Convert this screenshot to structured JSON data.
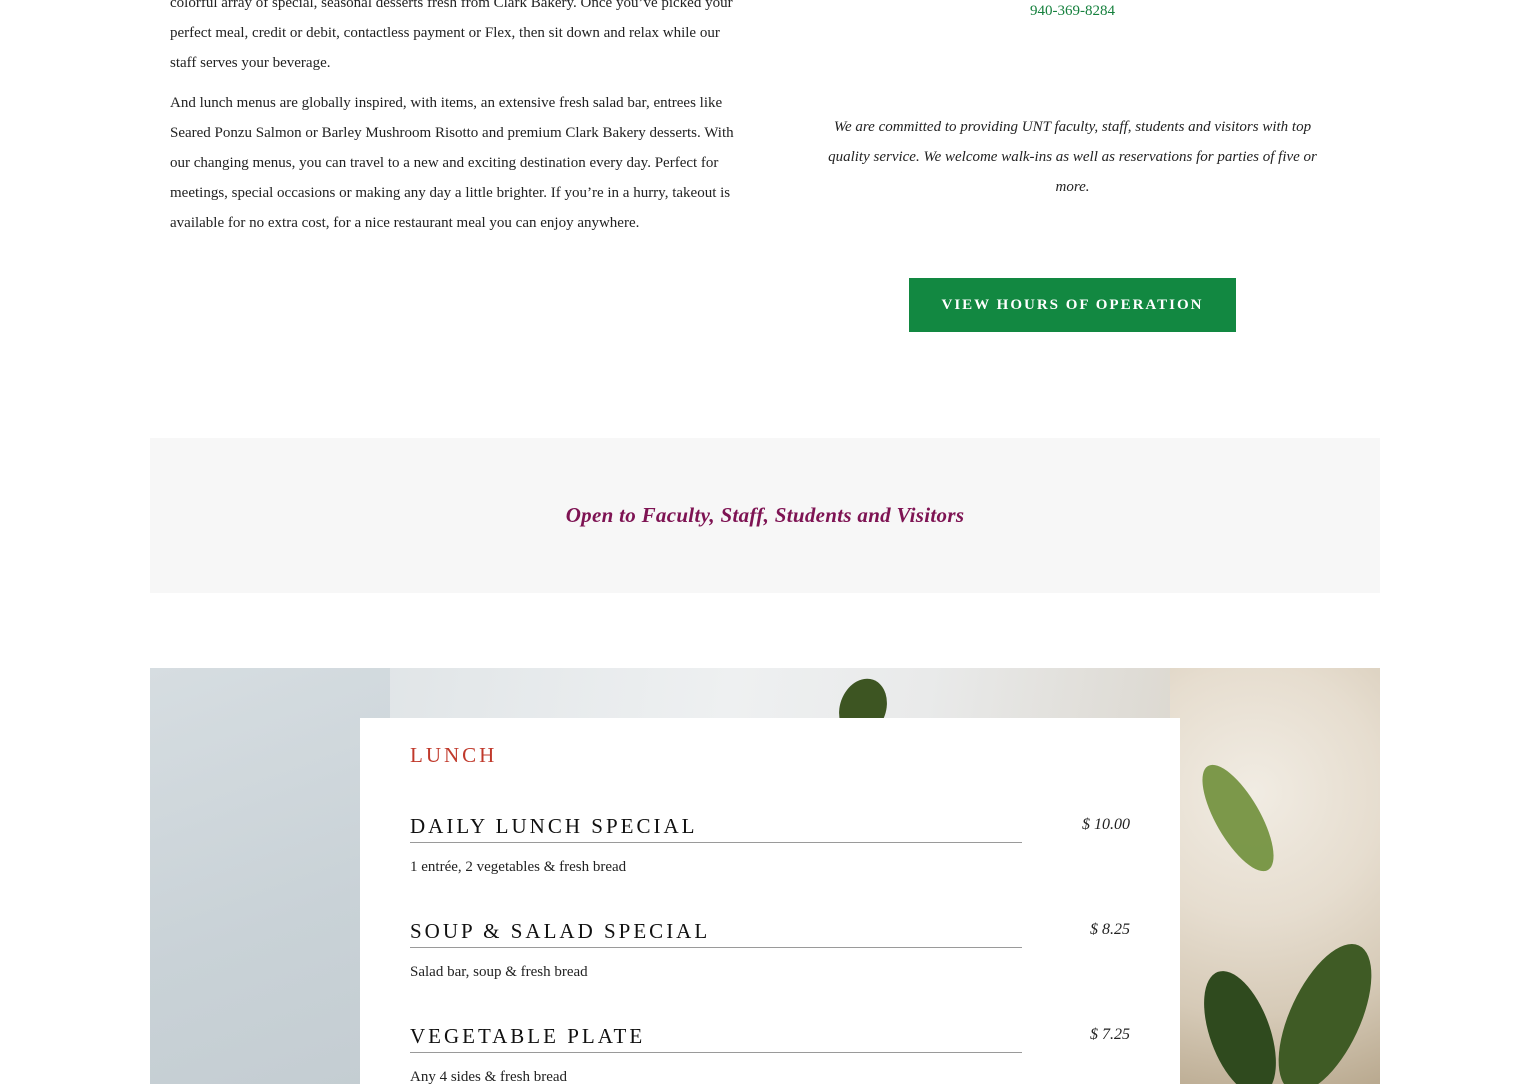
{
  "intro": {
    "para1": "colorful array of special, seasonal desserts fresh from Clark Bakery. Once you’ve picked your perfect meal, credit or debit, contactless payment or Flex, then sit down and relax while our staff serves your beverage.",
    "para2": "And lunch menus are globally inspired, with items, an extensive fresh salad bar, entrees like Seared Ponzu Salmon or Barley Mushroom Risotto and premium Clark Bakery desserts. With our changing menus, you can travel to a new and exciting destination every day. Perfect for meetings, special occasions or making any day a little brighter. If you’re in a hurry, takeout is available for no extra cost, for a nice restaurant meal you can enjoy anywhere."
  },
  "contact": {
    "phone": "940-369-8284",
    "commitment": "We are committed to providing UNT faculty, staff, students and visitors with top quality service. We welcome walk-ins as well as reservations for parties of five or more.",
    "hours_button": "VIEW HOURS OF OPERATION"
  },
  "banner": {
    "text": "Open to Faculty, Staff, Students and Visitors"
  },
  "menu": {
    "heading": "LUNCH",
    "items": [
      {
        "name": "DAILY LUNCH SPECIAL",
        "price": "$ 10.00",
        "description": "1 entrée, 2 vegetables & fresh bread"
      },
      {
        "name": "SOUP & SALAD SPECIAL",
        "price": "$ 8.25",
        "description": "Salad bar, soup & fresh bread"
      },
      {
        "name": "VEGETABLE PLATE",
        "price": "$ 7.25",
        "description": "Any 4 sides & fresh bread"
      }
    ]
  },
  "colors": {
    "accent_green": "#128841",
    "phone_green": "#15803d",
    "banner_text": "#7e1353",
    "menu_heading": "#c0392b"
  }
}
